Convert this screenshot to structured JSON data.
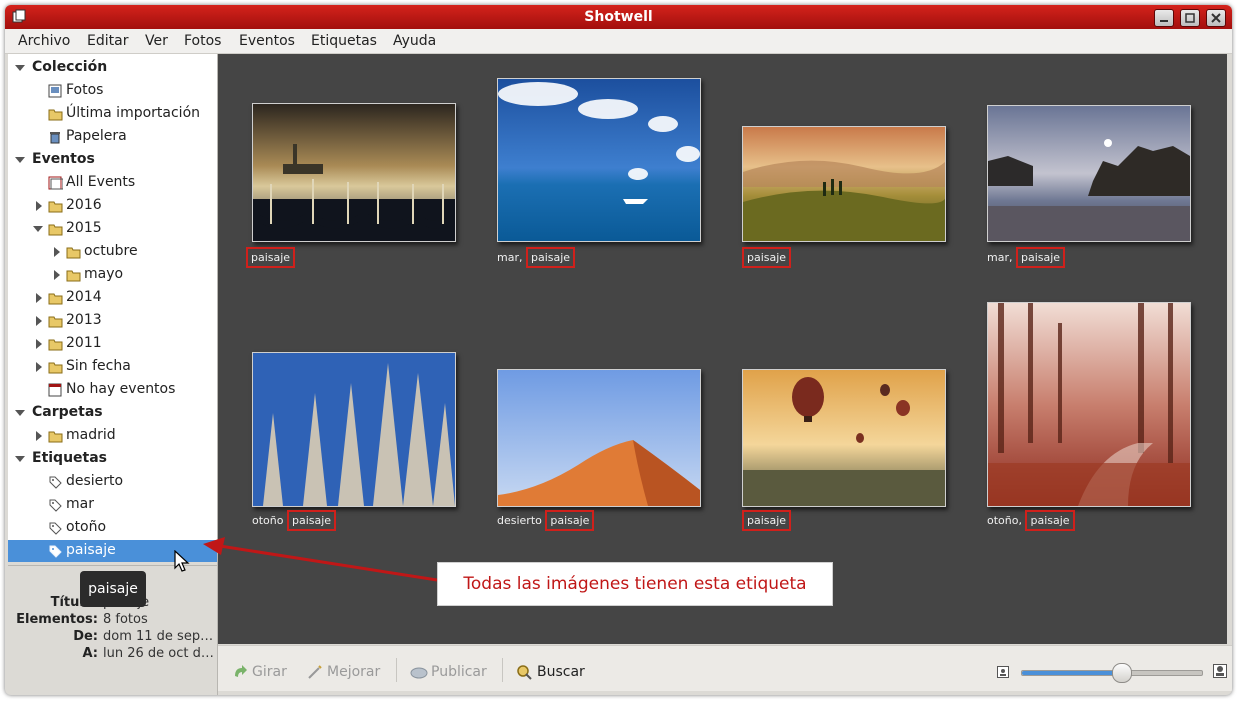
{
  "window": {
    "title": "Shotwell"
  },
  "menu": [
    "Archivo",
    "Editar",
    "Ver",
    "Fotos",
    "Eventos",
    "Etiquetas",
    "Ayuda"
  ],
  "sidebar": {
    "collection": {
      "label": "Colección",
      "items": [
        "Fotos",
        "Última importación",
        "Papelera"
      ]
    },
    "events": {
      "label": "Eventos",
      "all": "All Events",
      "y2016": "2016",
      "y2015": "2015",
      "octubre": "octubre",
      "mayo": "mayo",
      "y2014": "2014",
      "y2013": "2013",
      "y2011": "2011",
      "nodate": "Sin fecha",
      "noevents": "No hay eventos"
    },
    "folders": {
      "label": "Carpetas",
      "madrid": "madrid"
    },
    "tags": {
      "label": "Etiquetas",
      "items": [
        "desierto",
        "mar",
        "otoño",
        "paisaje"
      ],
      "selected": "paisaje"
    }
  },
  "tooltip": "paisaje",
  "info": {
    "titulo_label": "Título:",
    "titulo_value": "paisaje",
    "elementos_label": "Elementos:",
    "elementos_value": "8 fotos",
    "de_label": "De:",
    "de_value": "dom 11 de sep…",
    "a_label": "A:",
    "a_value": "lun 26 de oct d…"
  },
  "photos": [
    {
      "prefix": "",
      "tag": "paisaje",
      "subject": "gondolas-venice"
    },
    {
      "prefix": "mar,",
      "tag": "paisaje",
      "subject": "sea-boat"
    },
    {
      "prefix": "",
      "tag": "paisaje",
      "subject": "tuscany-hills"
    },
    {
      "prefix": "mar,",
      "tag": "paisaje",
      "subject": "moonlit-coast"
    },
    {
      "prefix": "otoño",
      "tag": "paisaje",
      "subject": "bare-poplars"
    },
    {
      "prefix": "desierto",
      "tag": "paisaje",
      "subject": "sand-dune"
    },
    {
      "prefix": "",
      "tag": "paisaje",
      "subject": "hot-air-balloons"
    },
    {
      "prefix": "otoño,",
      "tag": "paisaje",
      "subject": "autumn-forest-path"
    }
  ],
  "toolbar": {
    "rotate": "Girar",
    "enhance": "Mejorar",
    "publish": "Publicar",
    "search": "Buscar",
    "zoom_level": 0.55
  },
  "annotation": "Todas las imágenes tienen esta etiqueta",
  "colors": {
    "titlebar": "#c0180f",
    "selection": "#4a90d9",
    "viewer_bg": "#454545",
    "highlight": "#d0201b"
  }
}
